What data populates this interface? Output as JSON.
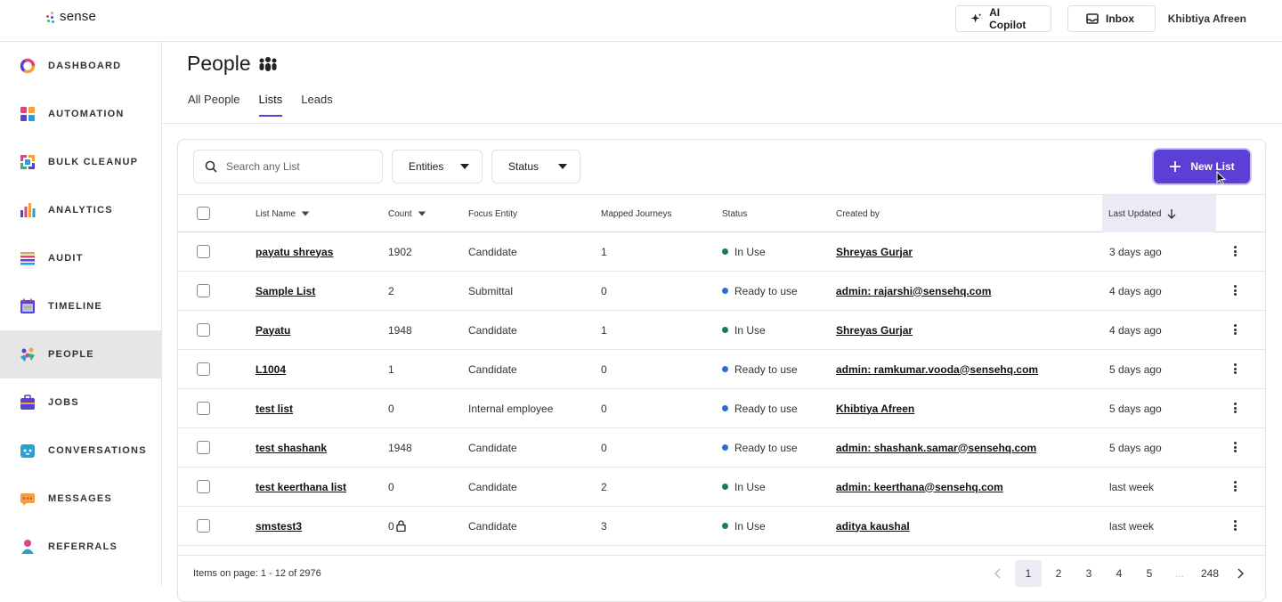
{
  "app": {
    "brand": "sense",
    "user_name": "Khibtiya Afreen",
    "copilot_label": "AI Copilot",
    "inbox_label": "Inbox",
    "accent": "#5b3fd6"
  },
  "sidebar": {
    "items": [
      {
        "label": "DASHBOARD",
        "icon": "dashboard-ring-icon"
      },
      {
        "label": "AUTOMATION",
        "icon": "automation-grid-icon"
      },
      {
        "label": "BULK CLEANUP",
        "icon": "bulk-cleanup-icon"
      },
      {
        "label": "ANALYTICS",
        "icon": "analytics-bars-icon"
      },
      {
        "label": "AUDIT",
        "icon": "audit-list-icon"
      },
      {
        "label": "TIMELINE",
        "icon": "timeline-icon"
      },
      {
        "label": "PEOPLE",
        "icon": "people-icon",
        "active": true
      },
      {
        "label": "JOBS",
        "icon": "briefcase-icon"
      },
      {
        "label": "CONVERSATIONS",
        "icon": "conversation-bot-icon"
      },
      {
        "label": "MESSAGES",
        "icon": "message-bubble-icon"
      },
      {
        "label": "REFERRALS",
        "icon": "referral-person-icon"
      }
    ]
  },
  "page": {
    "title": "People",
    "title_icon": "people-group-icon"
  },
  "tabs": [
    {
      "label": "All People"
    },
    {
      "label": "Lists",
      "active": true
    },
    {
      "label": "Leads"
    }
  ],
  "toolbar": {
    "search_placeholder": "Search any List",
    "entities_label": "Entities",
    "status_label": "Status",
    "new_list_label": "New List"
  },
  "table": {
    "columns": [
      "List Name",
      "Count",
      "Focus Entity",
      "Mapped Journeys",
      "Status",
      "Created by",
      "Last Updated"
    ],
    "rows": [
      {
        "name": "payatu shreyas",
        "count": "1902",
        "entity": "Candidate",
        "journeys": "1",
        "status": "In Use",
        "status_color": "#1a7f4b",
        "created_by": "Shreyas Gurjar",
        "updated": "3 days ago"
      },
      {
        "name": "Sample List",
        "count": "2",
        "entity": "Submittal",
        "journeys": "0",
        "status": "Ready to use",
        "status_color": "#2a6fd6",
        "created_by": "admin: rajarshi@sensehq.com",
        "updated": "4 days ago"
      },
      {
        "name": "Payatu",
        "count": "1948",
        "entity": "Candidate",
        "journeys": "1",
        "status": "In Use",
        "status_color": "#1a7f4b",
        "created_by": "Shreyas Gurjar",
        "updated": "4 days ago"
      },
      {
        "name": "L1004",
        "count": "1",
        "entity": "Candidate",
        "journeys": "0",
        "status": "Ready to use",
        "status_color": "#2a6fd6",
        "created_by": "admin: ramkumar.vooda@sensehq.com",
        "updated": "5 days ago"
      },
      {
        "name": "test list",
        "count": "0",
        "entity": "Internal employee",
        "journeys": "0",
        "status": "Ready to use",
        "status_color": "#2a6fd6",
        "created_by": "Khibtiya Afreen",
        "updated": "5 days ago"
      },
      {
        "name": "test shashank",
        "count": "1948",
        "entity": "Candidate",
        "journeys": "0",
        "status": "Ready to use",
        "status_color": "#2a6fd6",
        "created_by": "admin: shashank.samar@sensehq.com",
        "updated": "5 days ago"
      },
      {
        "name": "test keerthana list",
        "count": "0",
        "entity": "Candidate",
        "journeys": "2",
        "status": "In Use",
        "status_color": "#1a7f4b",
        "created_by": "admin: keerthana@sensehq.com",
        "updated": "last week"
      },
      {
        "name": "smstest3",
        "count": "0",
        "count_locked": true,
        "entity": "Candidate",
        "journeys": "3",
        "status": "In Use",
        "status_color": "#1a7f4b",
        "created_by": "aditya kaushal",
        "updated": "last week"
      }
    ]
  },
  "footer": {
    "items_text": "Items on page: 1 - 12 of 2976",
    "pages": [
      "1",
      "2",
      "3",
      "4",
      "5",
      "...",
      "248"
    ],
    "current_page": "1"
  }
}
